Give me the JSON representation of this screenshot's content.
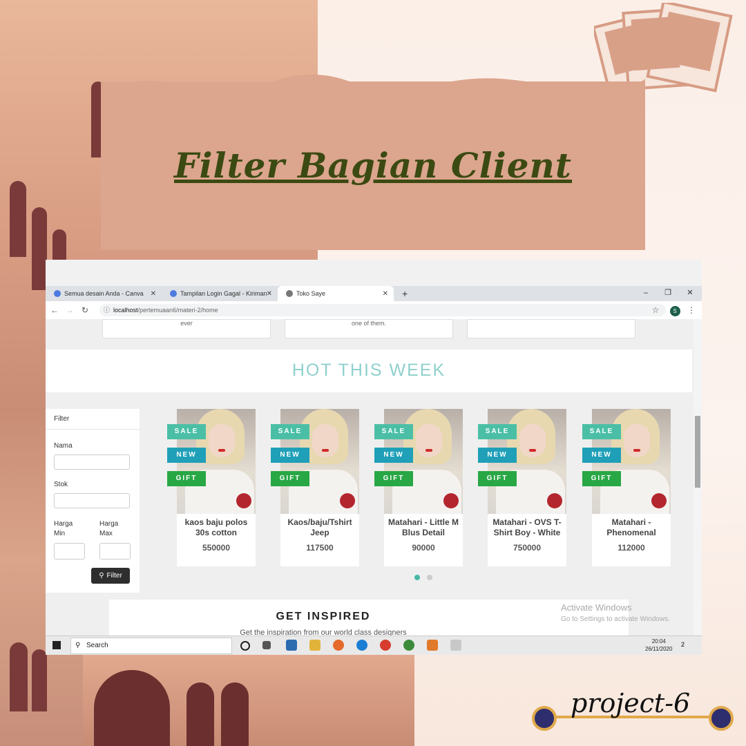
{
  "banner": {
    "title": "Filter Bagian Client"
  },
  "browser": {
    "tabs": [
      {
        "label": "Semua desain Anda - Canva",
        "icon": "canva-icon"
      },
      {
        "label": "Tampilan Login Gagal - Kiriman",
        "icon": "canva-icon"
      },
      {
        "label": "Toko Saye",
        "icon": "globe-icon"
      }
    ],
    "new_tab": "+",
    "window_controls": {
      "minimize": "–",
      "restore": "❐",
      "close": "✕"
    },
    "address": {
      "host": "localhost",
      "path": "/pertemuaan6/materi-2/home"
    },
    "profile_initial": "S"
  },
  "page": {
    "top_cards": [
      "ever",
      "one of them.",
      ""
    ],
    "hot_title": "HOT THIS WEEK",
    "filter": {
      "header": "Filter",
      "nama_label": "Nama",
      "stok_label": "Stok",
      "harga_min_label": "Harga Min",
      "harga_max_label": "Harga Max",
      "button_label": "Filter"
    },
    "ribbons": {
      "sale": "SALE",
      "new": "NEW",
      "gift": "GIFT"
    },
    "products": [
      {
        "name": "kaos baju polos 30s cotton",
        "price": "550000"
      },
      {
        "name": "Kaos/baju/Tshirt Jeep",
        "price": "117500"
      },
      {
        "name": "Matahari - Little M Blus Detail",
        "price": "90000"
      },
      {
        "name": "Matahari - OVS T-Shirt Boy - White",
        "price": "750000"
      },
      {
        "name": "Matahari - Phenomenal",
        "price": "112000"
      }
    ],
    "inspired_title": "GET INSPIRED",
    "inspired_sub": "Get the inspiration from our world class designers"
  },
  "windows": {
    "activate_title": "Activate Windows",
    "activate_sub": "Go to Settings to activate Windows.",
    "search_label": "Search",
    "time": "20:04",
    "date": "26/11/2020",
    "notifications": "2"
  },
  "tag": {
    "label": "project-6"
  },
  "colors": {
    "banner": "#dca58d",
    "title": "#3b4a12",
    "hot": "#8fd0cd",
    "sale": "#4bbfa6",
    "new": "#1fa0b8",
    "gift": "#28a745"
  }
}
